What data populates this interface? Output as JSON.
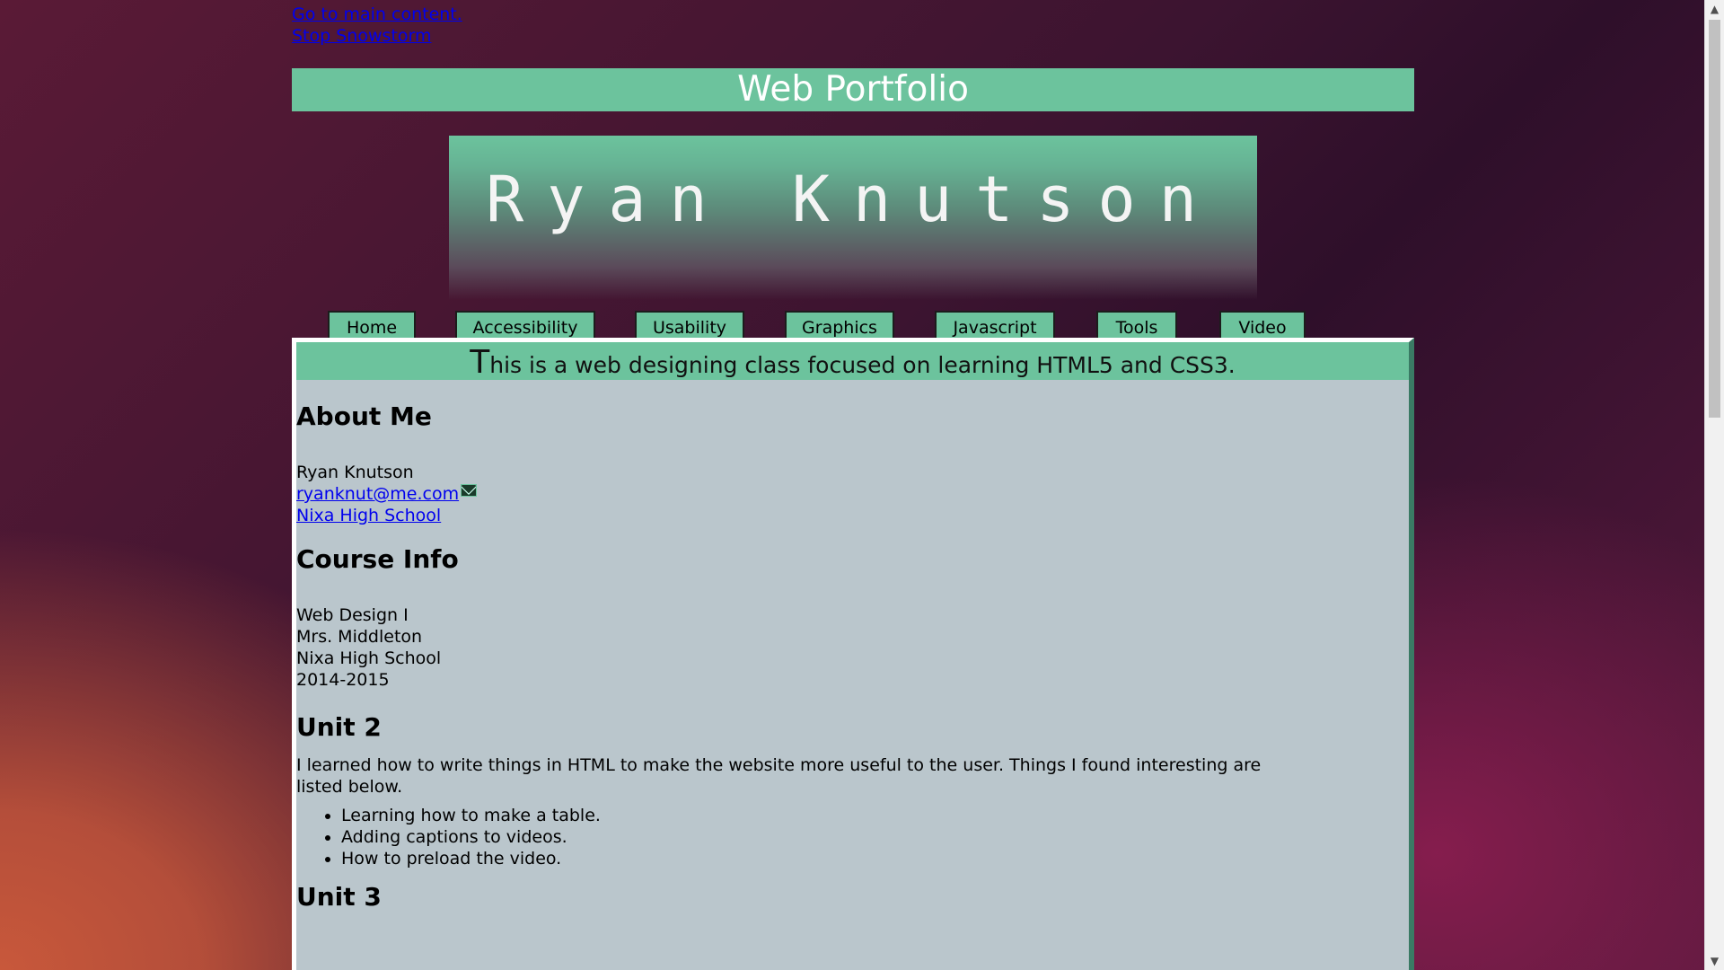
{
  "skip_links": {
    "main_content": "Go to main content.",
    "stop_snowstorm": "Stop Snowstorm"
  },
  "header": {
    "title": "Web Portfolio"
  },
  "banner": {
    "name": "Ryan Knutson"
  },
  "nav": {
    "items": [
      "Home",
      "Accessibility",
      "Usability",
      "Graphics",
      "Javascript",
      "Tools",
      "Video"
    ]
  },
  "main": {
    "tagline_first": "T",
    "tagline_rest": "his is a web designing class focused on learning HTML5 and CSS3.",
    "about": {
      "title": "About Me",
      "name": "Ryan Knutson",
      "email": "ryanknut@me.com",
      "school_link": "Nixa High School"
    },
    "course": {
      "title": "Course Info",
      "lines": [
        "Web Design I",
        "Mrs. Middleton",
        "Nixa High School",
        "2014-2015"
      ]
    },
    "unit2": {
      "title": "Unit 2",
      "paragraph": "I learned how to write things in HTML to make the website more useful to the user. Things I found interesting are listed below.",
      "items": [
        "Learning how to make a table.",
        "Adding captions to videos.",
        "How to preload the video."
      ]
    },
    "unit3": {
      "title": "Unit 3"
    }
  },
  "colors": {
    "accent": "#6cc39d",
    "content_bg": "#bac6cc",
    "link": "#0000ee"
  }
}
